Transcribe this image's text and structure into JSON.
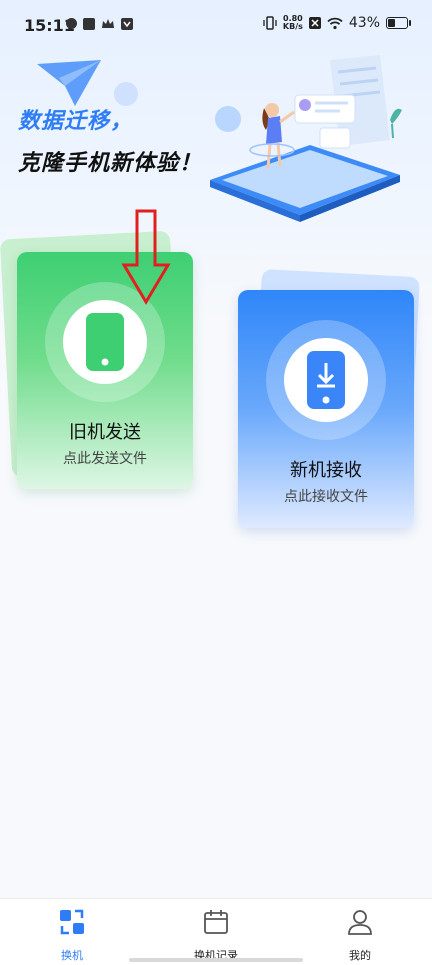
{
  "status_bar": {
    "time": "15:11",
    "net_speed_value": "0.80",
    "net_speed_unit": "KB/s",
    "battery": "43%",
    "battery_level": 0.43
  },
  "hero": {
    "line1": "数据迁移，",
    "line2": "克隆手机新体验！"
  },
  "cards": {
    "old": {
      "title": "旧机发送",
      "subtitle": "点此发送文件",
      "icon": "phone-icon"
    },
    "new": {
      "title": "新机接收",
      "subtitle": "点此接收文件",
      "icon": "phone-download-icon"
    }
  },
  "bottom_nav": {
    "items": [
      {
        "label": "换机",
        "icon": "swap-icon",
        "active": true
      },
      {
        "label": "换机记录",
        "icon": "calendar-icon",
        "active": false
      },
      {
        "label": "我的",
        "icon": "user-icon",
        "active": false
      }
    ]
  },
  "colors": {
    "accent": "#2f7df6",
    "green": "#3ecf73",
    "blue": "#2f86f9",
    "annotation_arrow": "#e02020"
  }
}
